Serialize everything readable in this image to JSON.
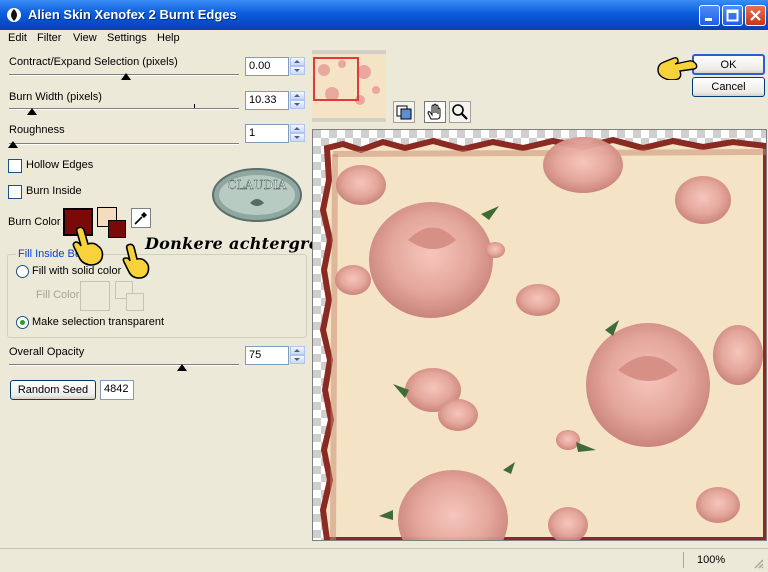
{
  "window": {
    "title": "Alien Skin Xenofex 2 Burnt Edges"
  },
  "menu": [
    "Edit",
    "Filter",
    "View",
    "Settings",
    "Help"
  ],
  "controls": {
    "contract_expand": {
      "label": "Contract/Expand Selection (pixels)",
      "value": "0.00",
      "position": 0.5
    },
    "burn_width": {
      "label": "Burn Width (pixels)",
      "value": "10.33",
      "position": 0.1
    },
    "roughness": {
      "label": "Roughness",
      "value": "1",
      "position": 0.01
    },
    "hollow_edges": {
      "label": "Hollow Edges",
      "checked": false
    },
    "burn_inside": {
      "label": "Burn Inside",
      "checked": false
    },
    "burn_color": {
      "label": "Burn Color",
      "color": "#7a0a0a",
      "bg_color": "#f3dcc0"
    },
    "fill_inside": {
      "group_label": "Fill Inside Burn",
      "solid_label": "Fill with solid color",
      "fill_color_label": "Fill Color",
      "transparent_label": "Make selection transparent",
      "selected": "transparent"
    },
    "overall_opacity": {
      "label": "Overall Opacity",
      "value": "75",
      "position": 0.75
    },
    "random_seed": {
      "button_label": "Random Seed",
      "value": "4842"
    }
  },
  "buttons": {
    "ok": "OK",
    "cancel": "Cancel"
  },
  "annotation": {
    "text": "Donkere achtergrondkleur",
    "watermark_text": "CLAUDIA"
  },
  "status": {
    "zoom": "100%"
  },
  "colors": {
    "accent": "#0a5ddc",
    "preview_bg": "#f5e3c6",
    "rose": "#e8a8a0",
    "burn": "#7a0a0a"
  }
}
